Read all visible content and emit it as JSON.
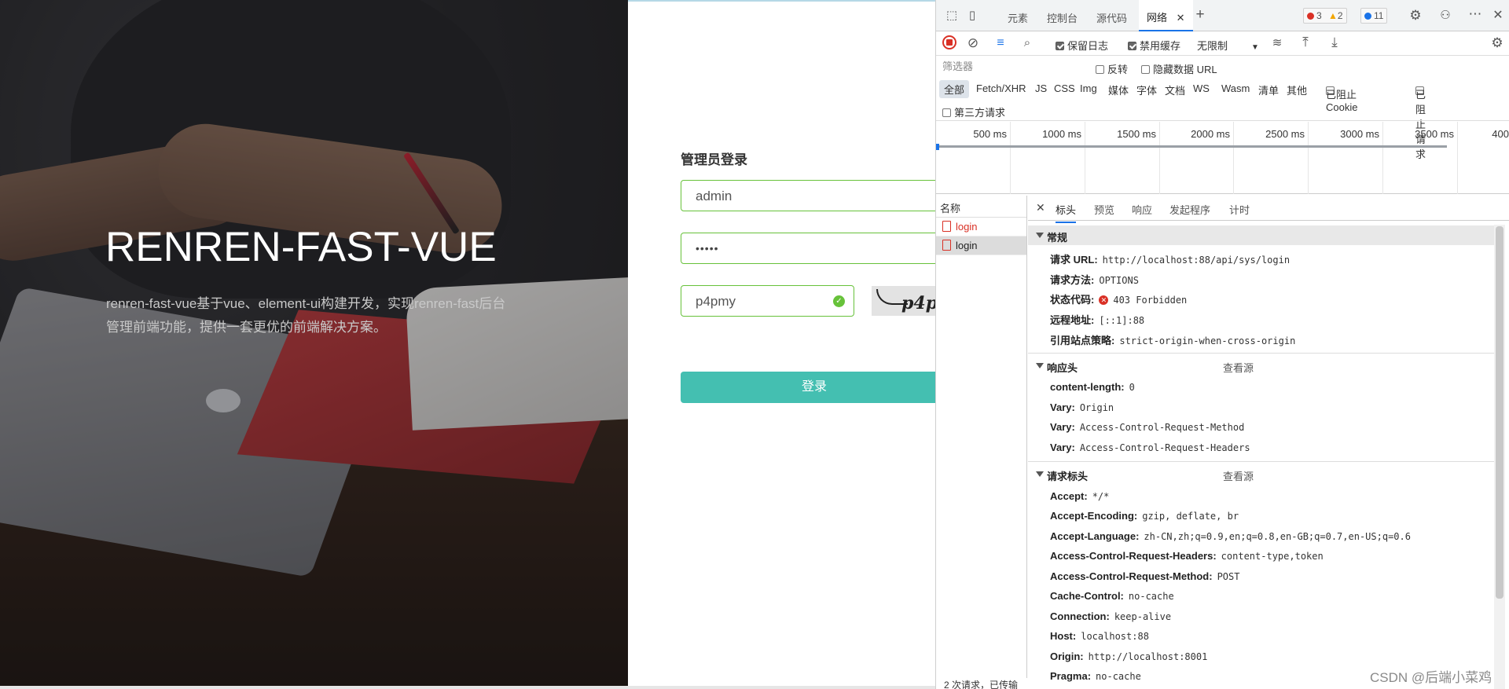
{
  "hero": {
    "brand": "RENREN-FAST-VUE",
    "description": "renren-fast-vue基于vue、element-ui构建开发，实现renren-fast后台管理前端功能，提供一套更优的前端解决方案。"
  },
  "login": {
    "title": "管理员登录",
    "username_value": "admin",
    "password_value": "•••••",
    "captcha_value": "p4pmy",
    "captcha_image_text": "p4p",
    "submit_label": "登录"
  },
  "devtools": {
    "tabs": [
      "元素",
      "控制台",
      "源代码",
      "网络"
    ],
    "active_tab": "网络",
    "badges": {
      "errors": "3",
      "warnings": "2",
      "info": "11"
    },
    "toolbar": {
      "preserve_log": "保留日志",
      "disable_cache": "禁用缓存",
      "throttle": "无限制"
    },
    "filter": {
      "placeholder": "筛选器",
      "invert": "反转",
      "hide_data_urls": "隐藏数据 URL",
      "types": [
        "全部",
        "Fetch/XHR",
        "JS",
        "CSS",
        "Img",
        "媒体",
        "字体",
        "文档",
        "WS",
        "Wasm",
        "清单",
        "其他"
      ],
      "blocked_cookies": "已阻止 Cookie",
      "blocked_requests": "已阻止请求",
      "third_party": "第三方请求"
    },
    "timeline_ticks": [
      "500 ms",
      "1000 ms",
      "1500 ms",
      "2000 ms",
      "2500 ms",
      "3000 ms",
      "3500 ms",
      "400"
    ],
    "requests_header": "名称",
    "requests": [
      {
        "name": "login",
        "status": "error"
      },
      {
        "name": "login",
        "status": "selected"
      }
    ],
    "requests_footer": "2 次请求，已传输",
    "detail_tabs": [
      "标头",
      "预览",
      "响应",
      "发起程序",
      "计时"
    ],
    "active_detail_tab": "标头",
    "view_source": "查看源",
    "general": {
      "title": "常规",
      "rows": [
        {
          "k": "请求 URL:",
          "v": "http://localhost:88/api/sys/login"
        },
        {
          "k": "请求方法:",
          "v": "OPTIONS"
        },
        {
          "k": "状态代码:",
          "v": "403 Forbidden"
        },
        {
          "k": "远程地址:",
          "v": "[::1]:88"
        },
        {
          "k": "引用站点策略:",
          "v": "strict-origin-when-cross-origin"
        }
      ]
    },
    "response_headers": {
      "title": "响应头",
      "rows": [
        {
          "k": "content-length:",
          "v": "0"
        },
        {
          "k": "Vary:",
          "v": "Origin"
        },
        {
          "k": "Vary:",
          "v": "Access-Control-Request-Method"
        },
        {
          "k": "Vary:",
          "v": "Access-Control-Request-Headers"
        }
      ]
    },
    "request_headers": {
      "title": "请求标头",
      "rows": [
        {
          "k": "Accept:",
          "v": "*/*"
        },
        {
          "k": "Accept-Encoding:",
          "v": "gzip, deflate, br"
        },
        {
          "k": "Accept-Language:",
          "v": "zh-CN,zh;q=0.9,en;q=0.8,en-GB;q=0.7,en-US;q=0.6"
        },
        {
          "k": "Access-Control-Request-Headers:",
          "v": "content-type,token"
        },
        {
          "k": "Access-Control-Request-Method:",
          "v": "POST"
        },
        {
          "k": "Cache-Control:",
          "v": "no-cache"
        },
        {
          "k": "Connection:",
          "v": "keep-alive"
        },
        {
          "k": "Host:",
          "v": "localhost:88"
        },
        {
          "k": "Origin:",
          "v": "http://localhost:8001"
        },
        {
          "k": "Pragma:",
          "v": "no-cache"
        }
      ]
    }
  },
  "watermark": "CSDN @后端小菜鸡",
  "colors": {
    "accent": "#44bfb1",
    "success": "#67c23a",
    "error": "#d93025",
    "link": "#1a73e8"
  }
}
